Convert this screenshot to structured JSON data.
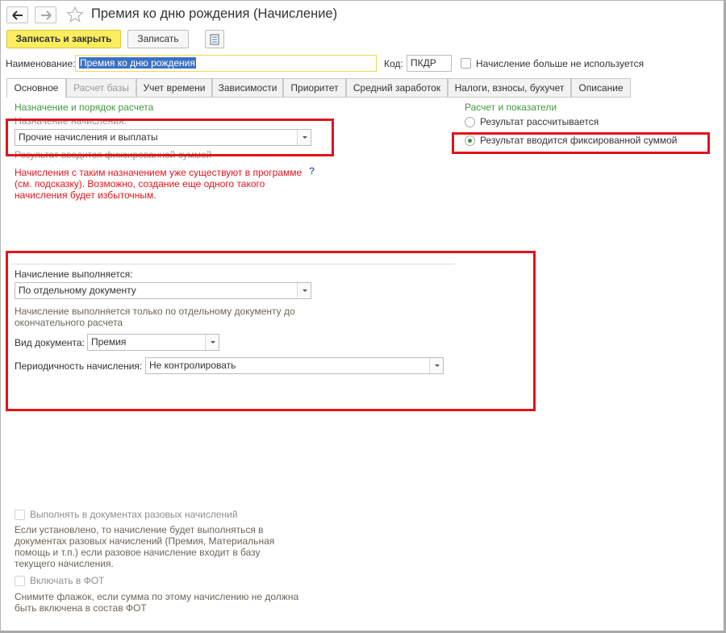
{
  "window": {
    "title": "Премия ко дню рождения (Начисление)"
  },
  "toolbar": {
    "save_close_label": "Записать и закрыть",
    "save_label": "Записать"
  },
  "header": {
    "name_label": "Наименование:",
    "name_value": "Премия ко дню рождения",
    "code_label": "Код:",
    "code_value": "ПКДР",
    "not_used_label": "Начисление больше не используется"
  },
  "tabs": [
    {
      "label": "Основное"
    },
    {
      "label": "Расчет базы"
    },
    {
      "label": "Учет времени"
    },
    {
      "label": "Зависимости"
    },
    {
      "label": "Приоритет"
    },
    {
      "label": "Средний заработок"
    },
    {
      "label": "Налоги, взносы, бухучет"
    },
    {
      "label": "Описание"
    }
  ],
  "main": {
    "purpose_section_title": "Назначение и порядок расчета",
    "purpose_label": "Назначение начисления:",
    "purpose_value": "Прочие начисления и выплаты",
    "purpose_hint": "Результат вводится фиксированной суммой",
    "warning": [
      "Начисления с таким назначением уже существуют в программе",
      "(см. подсказку). Возможно, создание еще одного такого",
      "начисления будет избыточным."
    ],
    "help_mark": "?",
    "calc_section_title": "Расчет и показатели",
    "radio_calculated": "Результат рассчитывается",
    "radio_fixed": "Результат вводится фиксированной суммой",
    "execution_label": "Начисление выполняется:",
    "execution_value": "По отдельному документу",
    "execution_desc": [
      "Начисление выполняется только по отдельному документу до",
      "окончательного расчета"
    ],
    "doc_type_label": "Вид документа:",
    "doc_type_value": "Премия",
    "periodicity_label": "Периодичность начисления:",
    "periodicity_value": "Не контролировать",
    "one_time_label": "Выполнять в документах разовых начислений",
    "one_time_desc": [
      "Если установлено, то начисление будет выполняться в",
      "документах разовых начислений (Премия, Материальная",
      "помощь и т.п.) если разовое начисление входит в базу",
      "текущего начисления."
    ],
    "fot_label": "Включать в ФОТ",
    "fot_desc": [
      "Снимите флажок, если сумма по этому начислению не должна",
      "быть включена в состав ФОТ"
    ]
  },
  "colors": {
    "accent_yellow": "#fbed5e",
    "section_green": "#3d9a3b",
    "warning_red": "#e2141b",
    "highlight_red": "#e0131c"
  }
}
